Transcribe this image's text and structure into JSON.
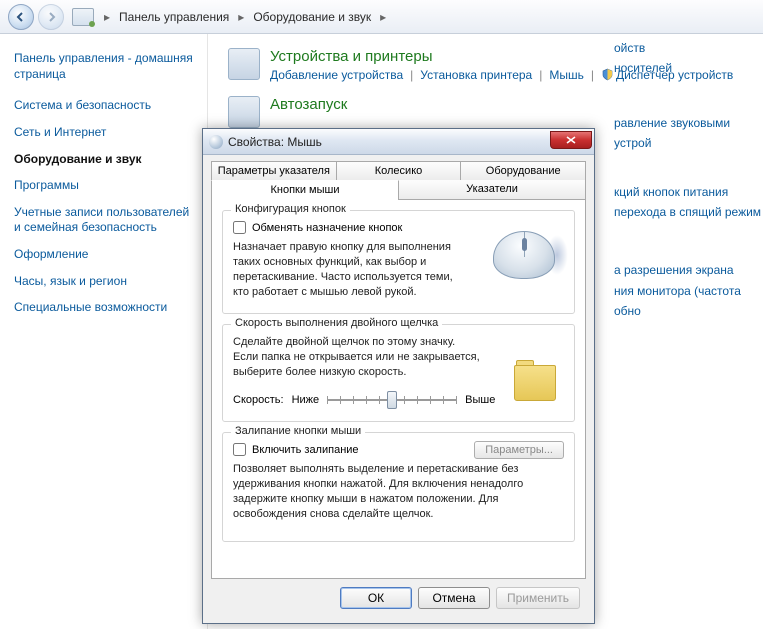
{
  "breadcrumb": {
    "root_sep": "▸",
    "item1": "Панель управления",
    "item2": "Оборудование и звук"
  },
  "sidebar": {
    "home": "Панель управления - домашняя страница",
    "items": [
      {
        "label": "Система и безопасность"
      },
      {
        "label": "Сеть и Интернет"
      },
      {
        "label": "Оборудование и звук"
      },
      {
        "label": "Программы"
      },
      {
        "label": "Учетные записи пользователей и семейная безопасность"
      },
      {
        "label": "Оформление"
      },
      {
        "label": "Часы, язык и регион"
      },
      {
        "label": "Специальные возможности"
      }
    ]
  },
  "content": {
    "cat1": {
      "title": "Устройства и принтеры",
      "links": [
        "Добавление устройства",
        "Установка принтера",
        "Мышь",
        "Диспетчер устройств"
      ]
    },
    "cat2": {
      "title": "Автозапуск"
    },
    "fragments": [
      "ойств",
      "носителей",
      "равление звуковыми устрой",
      "кций кнопок питания",
      "перехода в спящий режим",
      "а разрешения экрана",
      "ния монитора (частота обно"
    ]
  },
  "dialog": {
    "title": "Свойства: Мышь",
    "tabs_row1": [
      "Параметры указателя",
      "Колесико",
      "Оборудование"
    ],
    "tabs_row2": [
      "Кнопки мыши",
      "Указатели"
    ],
    "group1": {
      "title": "Конфигурация кнопок",
      "checkbox": "Обменять назначение кнопок",
      "desc": "Назначает правую кнопку для выполнения таких основных функций, как выбор и перетаскивание. Часто используется теми, кто работает с мышью левой рукой."
    },
    "group2": {
      "title": "Скорость выполнения двойного щелчка",
      "desc": "Сделайте двойной щелчок по этому значку. Если папка не открывается или не закрывается, выберите более низкую скорость.",
      "speed_label": "Скорость:",
      "low": "Ниже",
      "high": "Выше"
    },
    "group3": {
      "title": "Залипание кнопки мыши",
      "checkbox": "Включить залипание",
      "params": "Параметры...",
      "desc": "Позволяет выполнять выделение и перетаскивание без удерживания кнопки нажатой. Для включения ненадолго задержите кнопку мыши в нажатом положении. Для освобождения снова сделайте щелчок."
    },
    "buttons": {
      "ok": "ОК",
      "cancel": "Отмена",
      "apply": "Применить"
    }
  }
}
